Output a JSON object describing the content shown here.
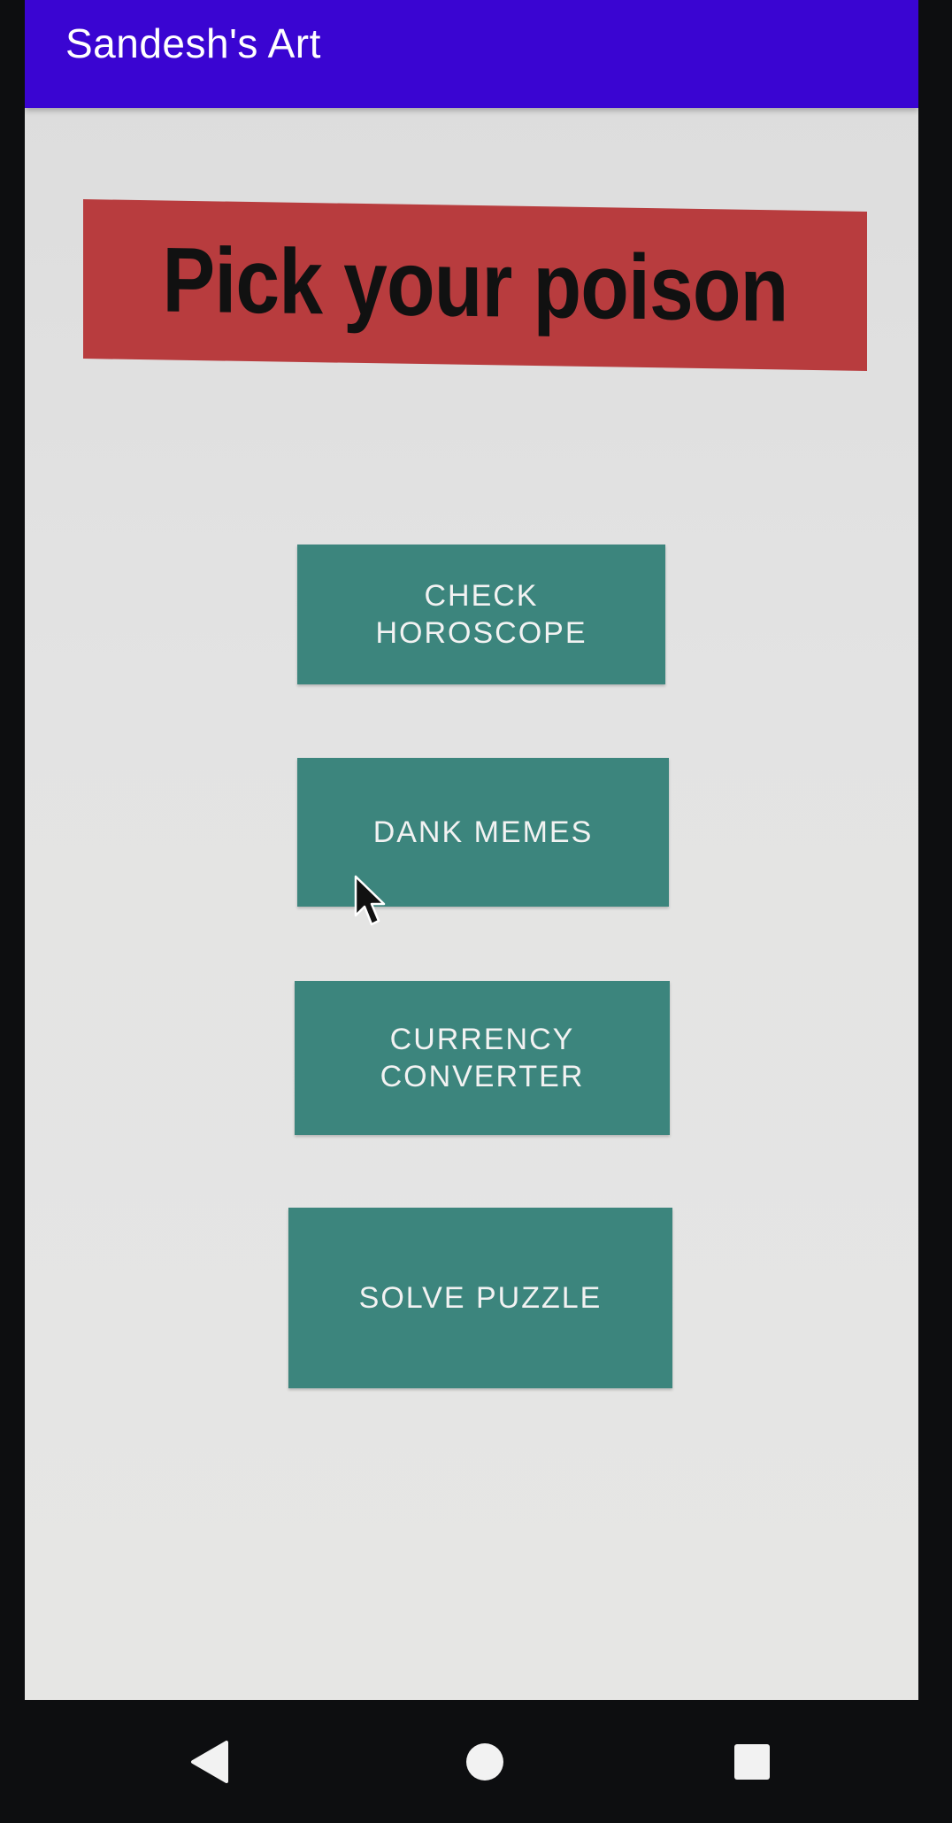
{
  "app_bar": {
    "title": "Sandesh's Art",
    "color": "#3a05d2"
  },
  "banner": {
    "text": "Pick your poison",
    "color": "#b83c3e"
  },
  "menu": {
    "button_color": "#3c857d",
    "buttons": [
      {
        "label": "CHECK\nHOROSCOPE"
      },
      {
        "label": "DANK MEMES"
      },
      {
        "label": "CURRENCY\nCONVERTER"
      },
      {
        "label": "SOLVE PUZZLE"
      }
    ]
  },
  "nav": {
    "back_icon": "back-triangle-icon",
    "home_icon": "home-circle-icon",
    "recent_icon": "recent-square-icon"
  },
  "pointer": {
    "icon": "mouse-pointer-icon"
  }
}
